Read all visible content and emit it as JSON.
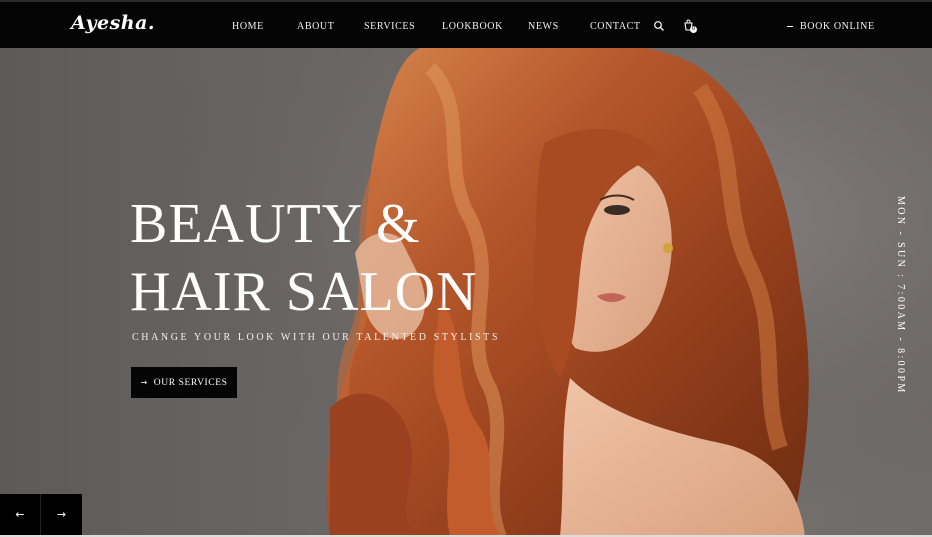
{
  "header": {
    "logo": "Ayesha.",
    "nav": [
      "HOME",
      "ABOUT",
      "SERVICES",
      "LOOKBOOK",
      "NEWS",
      "CONTACT"
    ],
    "cart_count": "0",
    "book_label": "BOOK ONLINE"
  },
  "hero": {
    "title_line1": "BEAUTY &",
    "title_line2": "HAIR SALON",
    "subtitle": "CHANGE YOUR LOOK WITH OUR TALENTED STYLISTS",
    "cta_arrow": "→",
    "cta_label": "OUR SERVICES",
    "hours": "MON - SUN : 7:00AM - 8:00PM",
    "prev_arrow": "←",
    "next_arrow": "→"
  },
  "colors": {
    "header_bg": "#050505",
    "hero_bg": "#6a6664",
    "hair": "#b5562a",
    "button_bg": "#050505"
  },
  "icons": [
    "search-icon",
    "cart-icon",
    "arrow-left-icon",
    "arrow-right-icon"
  ]
}
